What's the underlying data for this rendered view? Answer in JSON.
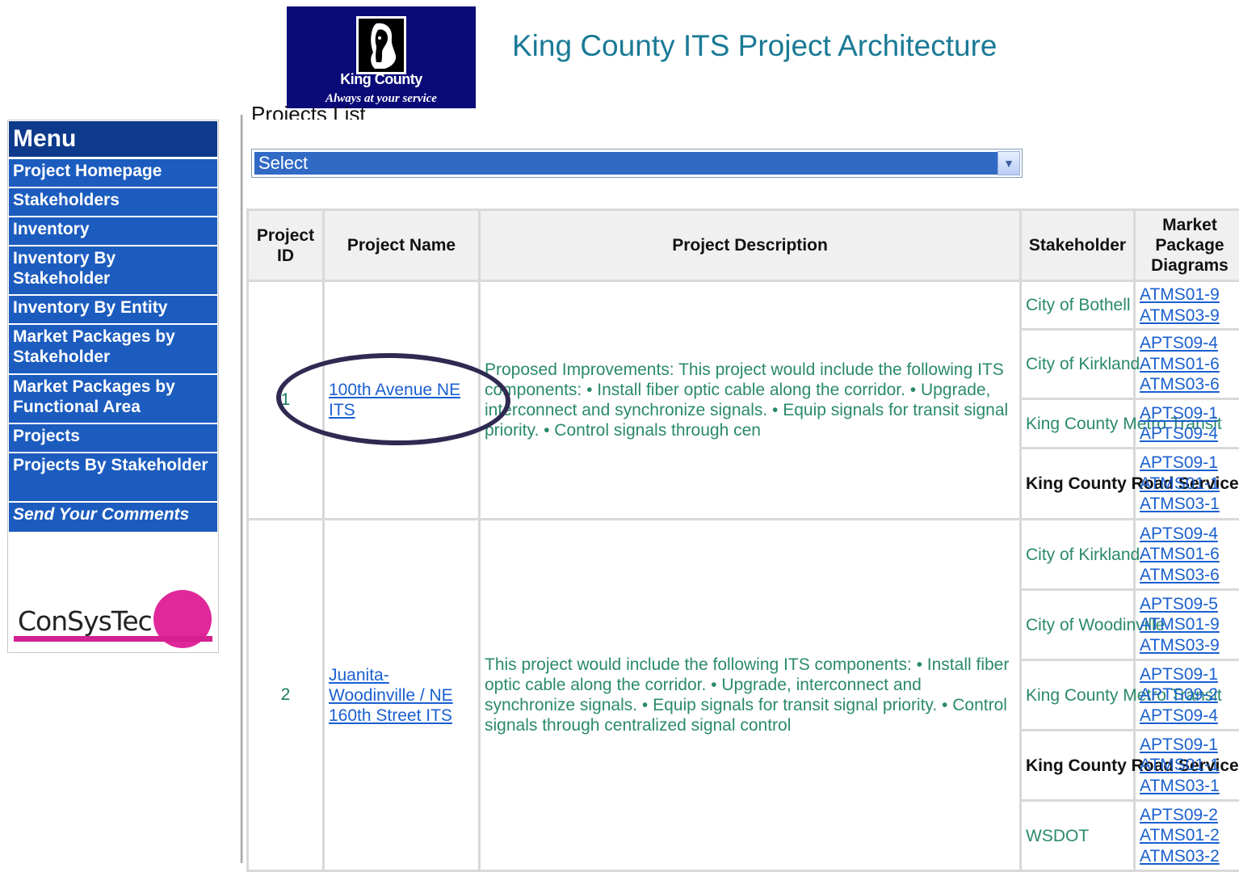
{
  "logo": {
    "brand": "King County",
    "tagline": "Always at your service"
  },
  "site_title": "King County ITS Project Architecture",
  "menu": {
    "heading": "Menu",
    "items": [
      {
        "label": "Project Homepage"
      },
      {
        "label": "Stakeholders"
      },
      {
        "label": "Inventory"
      },
      {
        "label": "Inventory By Stakeholder"
      },
      {
        "label": "Inventory By Entity"
      },
      {
        "label": "Market Packages by Stakeholder"
      },
      {
        "label": "Market Packages by Functional Area"
      },
      {
        "label": "Projects"
      },
      {
        "label": "Projects By Stakeholder"
      },
      {
        "label": "Send Your Comments"
      }
    ]
  },
  "sponsor": "ConSysTec",
  "page_heading": "Projects List",
  "project_select": {
    "value": "Select"
  },
  "table": {
    "headers": [
      "Project ID",
      "Project Name",
      "Project Description",
      "Stakeholder",
      "Market Package Diagrams"
    ],
    "projects": [
      {
        "id": "1",
        "name": "100th Avenue NE ITS",
        "description": "Proposed Improvements: This project would include the following ITS components: • Install fiber optic cable along the corridor. • Upgrade, interconnect and synchronize signals. • Equip signals for transit signal priority. • Control signals through cen",
        "stakeholders": [
          {
            "name": "City of Bothell",
            "packages": [
              "ATMS01-9",
              "ATMS03-9"
            ]
          },
          {
            "name": "City of Kirkland",
            "packages": [
              "APTS09-4",
              "ATMS01-6",
              "ATMS03-6"
            ]
          },
          {
            "name": "King County Metro Transit",
            "packages": [
              "APTS09-1",
              "APTS09-4"
            ]
          },
          {
            "name": "King County Road Services",
            "packages": [
              "APTS09-1",
              "ATMS01-1",
              "ATMS03-1"
            ]
          }
        ]
      },
      {
        "id": "2",
        "name": "Juanita-Woodinville / NE 160th Street ITS",
        "description": "This project would include the following ITS components: • Install fiber optic cable along the corridor. • Upgrade, interconnect and synchronize signals. • Equip signals for transit signal priority. • Control signals through centralized signal control",
        "stakeholders": [
          {
            "name": "City of Kirkland",
            "packages": [
              "APTS09-4",
              "ATMS01-6",
              "ATMS03-6"
            ]
          },
          {
            "name": "City of Woodinville",
            "packages": [
              "APTS09-5",
              "ATMS01-9",
              "ATMS03-9"
            ]
          },
          {
            "name": "King County Metro Transit",
            "packages": [
              "APTS09-1",
              "APTS09-2",
              "APTS09-4"
            ]
          },
          {
            "name": "King County Road Services",
            "packages": [
              "APTS09-1",
              "ATMS01-1",
              "ATMS03-1"
            ]
          },
          {
            "name": "WSDOT",
            "packages": [
              "APTS09-2",
              "ATMS01-2",
              "ATMS03-2"
            ]
          }
        ]
      }
    ]
  }
}
